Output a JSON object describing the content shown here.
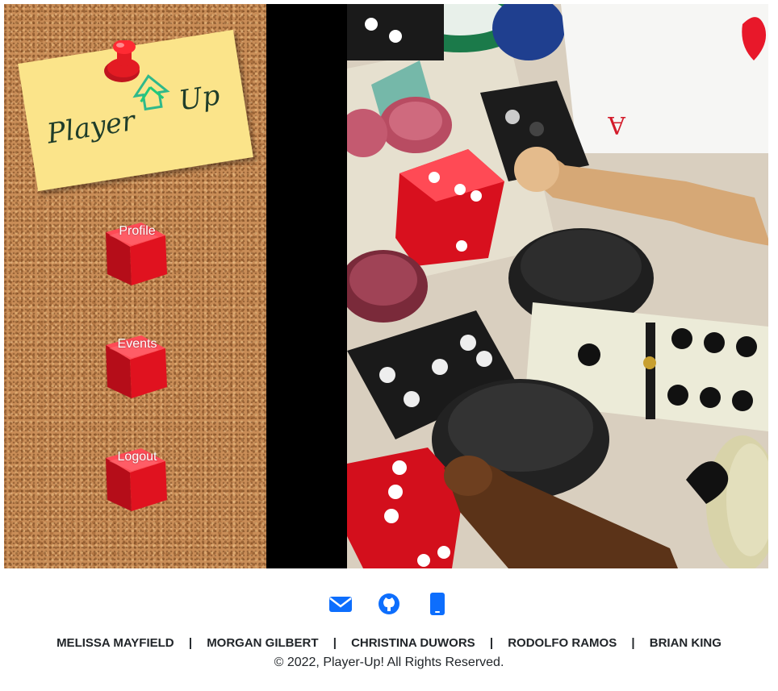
{
  "brand": {
    "logo_text_left": "Player",
    "logo_text_right": "Up"
  },
  "nav": {
    "items": [
      {
        "label": "Profile"
      },
      {
        "label": "Events"
      },
      {
        "label": "Logout"
      }
    ]
  },
  "hero": {
    "image_icon": "board-games-photo"
  },
  "footer": {
    "icons": [
      "envelope-icon",
      "github-icon",
      "mobile-phone-icon"
    ],
    "authors": [
      "MELISSA MAYFIELD",
      "MORGAN GILBERT",
      "CHRISTINA DUWORS",
      "RODOLFO RAMOS",
      "BRIAN KING"
    ],
    "separator": "|",
    "copyright": "© 2022, Player-Up! All Rights Reserved."
  },
  "colors": {
    "link_blue": "#0d6efd",
    "note_yellow": "#fbe48a",
    "die_red": "#d8121f",
    "logo_green": "#2fb98a"
  }
}
